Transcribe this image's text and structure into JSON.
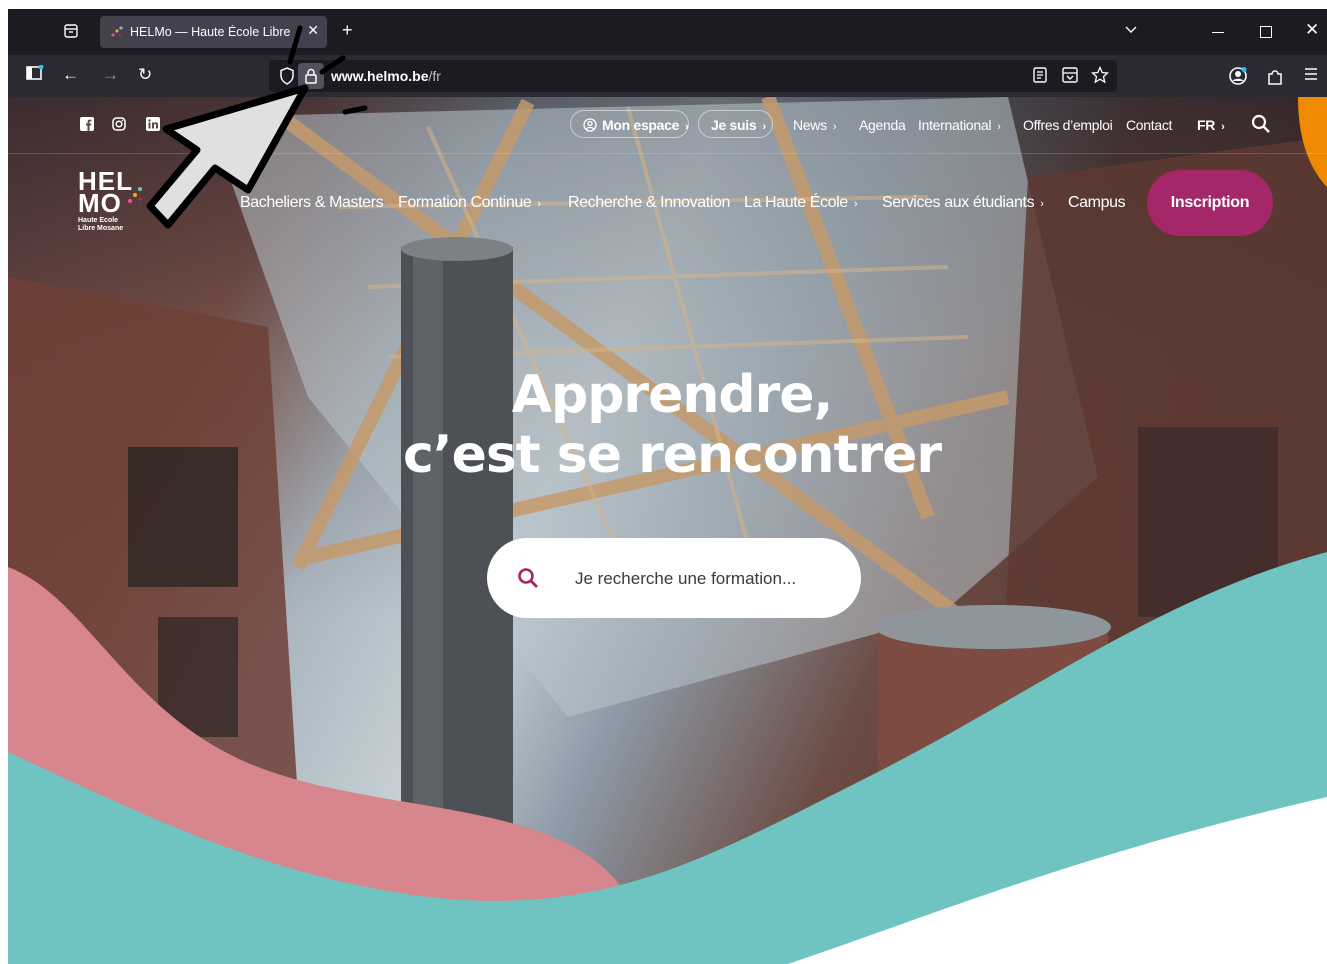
{
  "browser": {
    "tab_title": "HELMo — Haute École Libre Mosane",
    "url_host": "www.helmo.be",
    "url_path": "/fr",
    "new_tab": "+",
    "tab_close": "✕",
    "back": "←",
    "forward": "→",
    "reload": "↻",
    "window_close": "✕"
  },
  "site": {
    "logo": {
      "line1": "HEL",
      "line2": "MO",
      "sub1": "Haute Ecole",
      "sub2": "Libre Mosane"
    },
    "topbar": {
      "mon_espace": "Mon espace",
      "je_suis": "Je suis",
      "links": [
        "News",
        "Agenda",
        "International",
        "Offres d’emploi",
        "Contact"
      ],
      "language": "FR"
    },
    "mainnav": [
      "Bacheliers & Masters",
      "Formation Continue",
      "Recherche & Innovation",
      "La Haute École",
      "Services aux étudiants",
      "Campus"
    ],
    "cta": "Inscription",
    "headline_1": "Apprendre,",
    "headline_2": "c’est se rencontrer",
    "search_placeholder": "Je recherche une formation..."
  },
  "colors": {
    "brand": "#a5276a",
    "teal": "#6fc4c1",
    "pink": "#d6868c",
    "orange": "#f08a00"
  }
}
